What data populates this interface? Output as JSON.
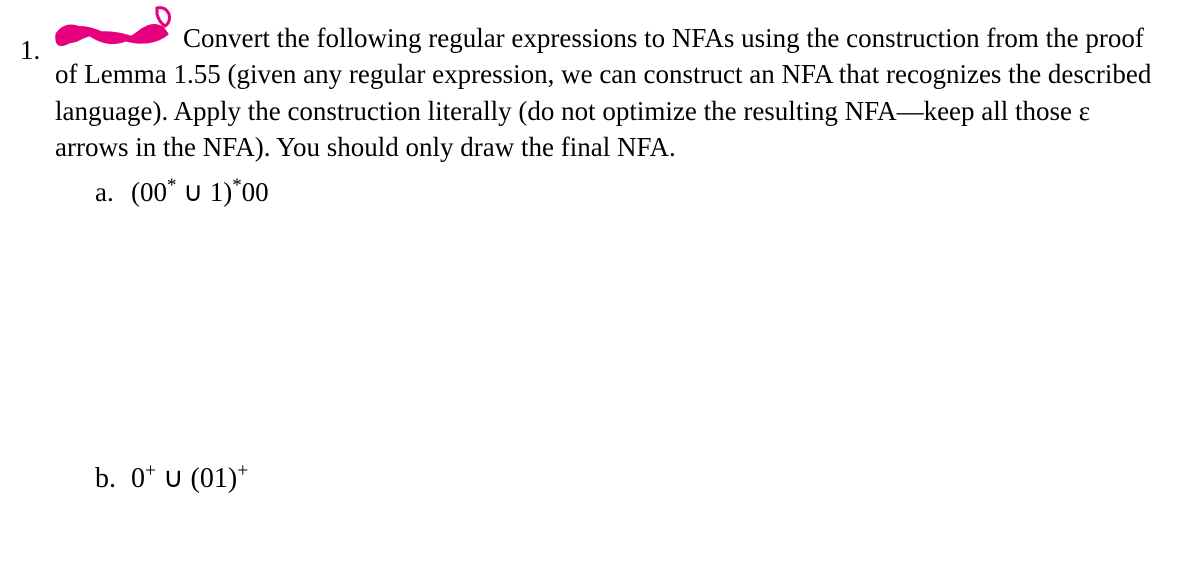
{
  "question_number": "1.",
  "prompt": "Convert the following regular expressions to NFAs using the construction from the proof of Lemma 1.55 (given any regular expression, we can construct an NFA that recognizes the described language). Apply the construction literally (do not optimize the resulting NFA—keep all those ε arrows in the NFA). You should only draw the final NFA.",
  "subparts": [
    {
      "label": "a.",
      "expression_html": "(00* ∪ 1)*00"
    },
    {
      "label": "b.",
      "expression_html": "0⁺ ∪ (01)⁺"
    }
  ]
}
